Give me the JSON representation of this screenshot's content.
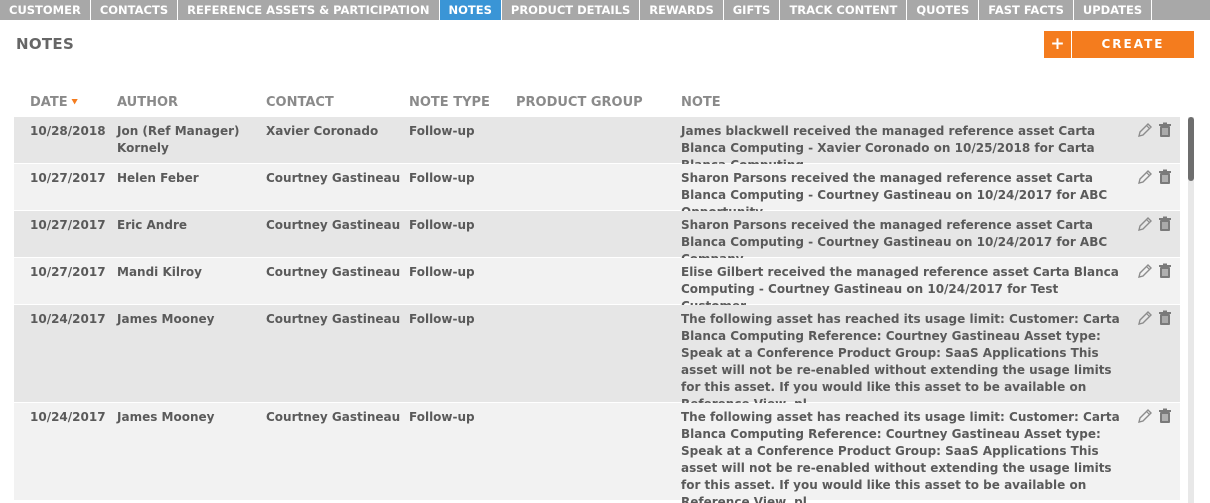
{
  "tabs": [
    {
      "label": "CUSTOMER",
      "active": false
    },
    {
      "label": "CONTACTS",
      "active": false
    },
    {
      "label": "REFERENCE ASSETS & PARTICIPATION",
      "active": false
    },
    {
      "label": "NOTES",
      "active": true
    },
    {
      "label": "PRODUCT DETAILS",
      "active": false
    },
    {
      "label": "REWARDS",
      "active": false
    },
    {
      "label": "GIFTS",
      "active": false
    },
    {
      "label": "TRACK CONTENT",
      "active": false
    },
    {
      "label": "QUOTES",
      "active": false
    },
    {
      "label": "FAST FACTS",
      "active": false
    },
    {
      "label": "UPDATES",
      "active": false
    }
  ],
  "page_title": "NOTES",
  "create_button": {
    "icon": "+",
    "label": "CREATE"
  },
  "columns": {
    "date": "DATE",
    "author": "AUTHOR",
    "contact": "CONTACT",
    "note_type": "NOTE TYPE",
    "product_group": "PRODUCT GROUP",
    "note": "NOTE"
  },
  "sort": {
    "column": "date",
    "direction": "descending",
    "icon": "chevron-down-icon"
  },
  "colors": {
    "tabbar": "#a8a8a8",
    "active_tab": "#3a95d6",
    "accent": "#f47c1e",
    "row_odd": "#e6e6e6",
    "row_even": "#f2f2f2"
  },
  "rows": [
    {
      "date": "10/28/2018",
      "author": "Jon (Ref Manager) Kornely",
      "contact": "Xavier Coronado",
      "note_type": "Follow-up",
      "product_group": "",
      "note": "James blackwell received the managed reference asset Carta Blanca Computing - Xavier Coronado on 10/25/2018 for Carta Blanca Computing."
    },
    {
      "date": "10/27/2017",
      "author": "Helen Feber",
      "contact": "Courtney Gastineau",
      "note_type": "Follow-up",
      "product_group": "",
      "note": "Sharon Parsons received the managed reference asset Carta Blanca Computing - Courtney Gastineau on 10/24/2017 for ABC Opportunity."
    },
    {
      "date": "10/27/2017",
      "author": "Eric Andre",
      "contact": "Courtney Gastineau",
      "note_type": "Follow-up",
      "product_group": "",
      "note": "Sharon Parsons received the managed reference asset Carta Blanca Computing - Courtney Gastineau on 10/24/2017 for ABC Company."
    },
    {
      "date": "10/27/2017",
      "author": "Mandi Kilroy",
      "contact": "Courtney Gastineau",
      "note_type": "Follow-up",
      "product_group": "",
      "note": "Elise Gilbert received the managed reference asset Carta Blanca Computing - Courtney Gastineau on 10/24/2017 for Test Customer."
    },
    {
      "date": "10/24/2017",
      "author": "James Mooney",
      "contact": "Courtney Gastineau",
      "note_type": "Follow-up",
      "product_group": "",
      "note": "The following asset has reached its usage limit: Customer: Carta Blanca Computing Reference: Courtney Gastineau Asset type: Speak at a Conference Product Group: SaaS Applications This asset will not be re-enabled without extending the usage limits for this asset. If you would like this asset to be available on Reference View, pl..."
    },
    {
      "date": "10/24/2017",
      "author": "James Mooney",
      "contact": "Courtney Gastineau",
      "note_type": "Follow-up",
      "product_group": "",
      "note": "The following asset has reached its usage limit: Customer: Carta Blanca Computing Reference: Courtney Gastineau Asset type: Speak at a Conference Product Group: SaaS Applications This asset will not be re-enabled without extending the usage limits for this asset. If you would like this asset to be available on Reference View, pl..."
    }
  ]
}
